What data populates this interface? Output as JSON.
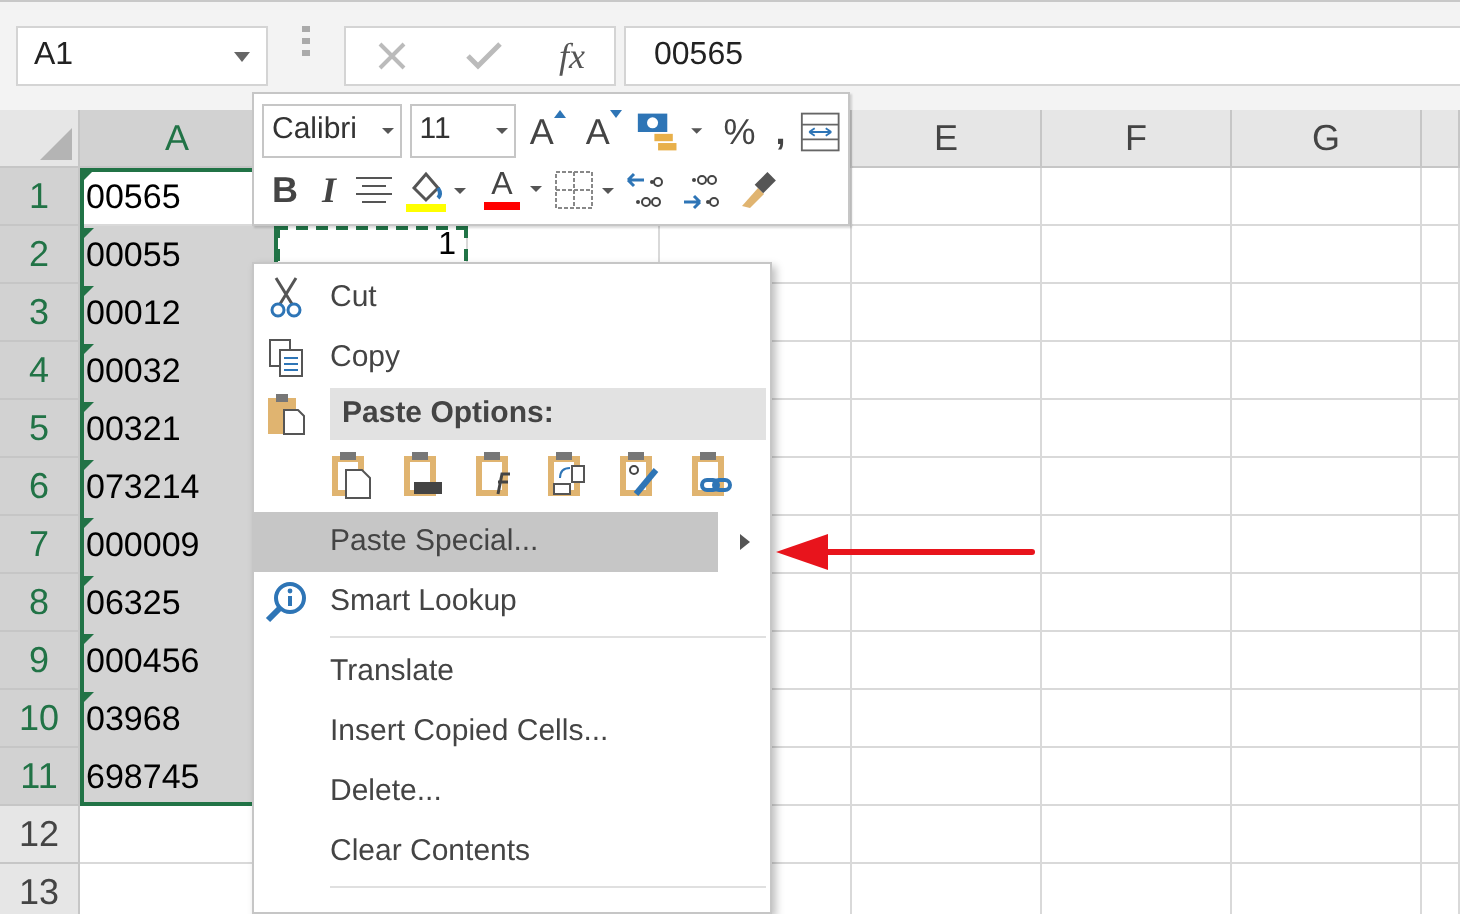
{
  "name_box": {
    "value": "A1"
  },
  "formula_bar": {
    "fx": "fx",
    "value": "00565"
  },
  "columns": [
    {
      "label": "A",
      "selected": true
    },
    {
      "label": "E",
      "selected": false
    },
    {
      "label": "F",
      "selected": false
    },
    {
      "label": "G",
      "selected": false
    }
  ],
  "rows": [
    {
      "number": "1",
      "selected": true,
      "cells": [
        {
          "text": "00565",
          "flag": true,
          "active": true
        }
      ]
    },
    {
      "number": "2",
      "selected": true,
      "cells": [
        {
          "text": "00055",
          "flag": true,
          "active": false
        },
        {
          "text": "1",
          "flag": false,
          "copied": true
        }
      ]
    },
    {
      "number": "3",
      "selected": true,
      "cells": [
        {
          "text": "00012",
          "flag": true,
          "active": false
        }
      ]
    },
    {
      "number": "4",
      "selected": true,
      "cells": [
        {
          "text": "00032",
          "flag": true,
          "active": false
        }
      ]
    },
    {
      "number": "5",
      "selected": true,
      "cells": [
        {
          "text": "00321",
          "flag": true,
          "active": false
        }
      ]
    },
    {
      "number": "6",
      "selected": true,
      "cells": [
        {
          "text": "073214",
          "flag": true,
          "active": false
        }
      ]
    },
    {
      "number": "7",
      "selected": true,
      "cells": [
        {
          "text": "000009",
          "flag": true,
          "active": false
        }
      ]
    },
    {
      "number": "8",
      "selected": true,
      "cells": [
        {
          "text": "06325",
          "flag": true,
          "active": false
        }
      ]
    },
    {
      "number": "9",
      "selected": true,
      "cells": [
        {
          "text": "000456",
          "flag": true,
          "active": false
        }
      ]
    },
    {
      "number": "10",
      "selected": true,
      "cells": [
        {
          "text": "03968",
          "flag": true,
          "active": false
        }
      ]
    },
    {
      "number": "11",
      "selected": true,
      "cells": [
        {
          "text": "698745",
          "flag": false,
          "active": false
        }
      ]
    },
    {
      "number": "12",
      "selected": false,
      "cells": []
    },
    {
      "number": "13",
      "selected": false,
      "cells": []
    }
  ],
  "mini_toolbar": {
    "font": "Calibri",
    "size": "11",
    "row_1": [
      {
        "kind": "grow",
        "label": "A"
      },
      {
        "kind": "shrink",
        "label": "A"
      },
      {
        "kind": "icon"
      },
      {
        "kind": "text",
        "label": "%"
      },
      {
        "kind": "text",
        "label": ","
      },
      {
        "kind": "icon"
      }
    ],
    "row_2": [
      {
        "kind": "bold",
        "label": "B"
      },
      {
        "kind": "italic",
        "label": "I"
      },
      {
        "kind": "icon"
      },
      {
        "kind": "icon",
        "color": "#ffff00"
      },
      {
        "kind": "color_text",
        "label": "A",
        "color": "#ff0000"
      },
      {
        "kind": "icon"
      },
      {
        "kind": "icon"
      },
      {
        "kind": "icon"
      },
      {
        "kind": "icon"
      }
    ]
  },
  "context_menu": [
    {
      "kind": "command",
      "label": "Cut",
      "selected": false
    },
    {
      "kind": "command",
      "label": "Copy",
      "selected": false
    },
    {
      "kind": "header",
      "label": "Paste Options:"
    },
    {
      "kind": "paste_icons"
    },
    {
      "kind": "command",
      "label": "Paste Special...",
      "selected": true,
      "submenu": true
    },
    {
      "kind": "command",
      "label": "Smart Lookup",
      "selected": false
    },
    {
      "kind": "divider"
    },
    {
      "kind": "command",
      "label": "Translate",
      "selected": false
    },
    {
      "kind": "command",
      "label": "Insert Copied Cells...",
      "selected": false
    },
    {
      "kind": "command",
      "label": "Delete...",
      "selected": false
    },
    {
      "kind": "command",
      "label": "Clear Contents",
      "selected": false
    },
    {
      "kind": "divider"
    }
  ],
  "annotation_arrow": {
    "color": "#e8141c"
  }
}
